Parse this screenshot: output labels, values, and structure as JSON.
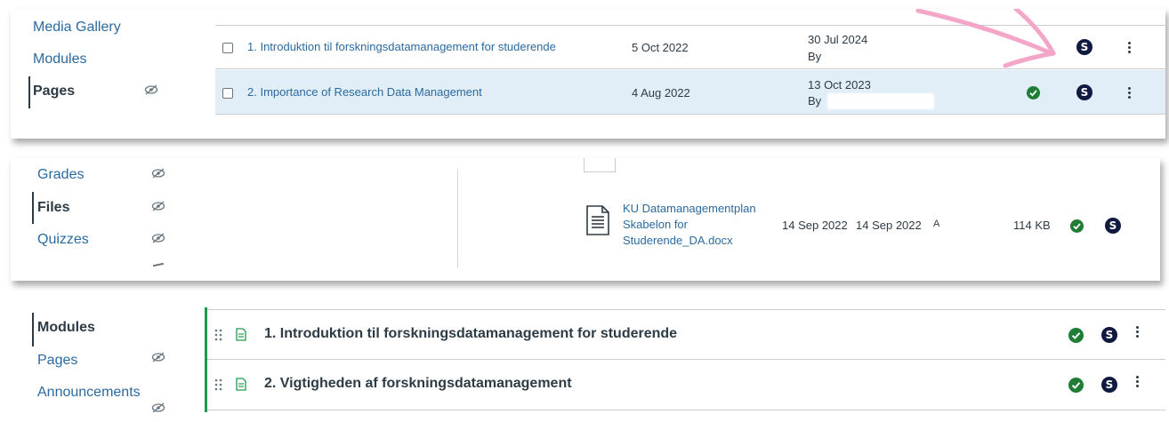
{
  "panel1": {
    "nav": {
      "media_gallery": "Media Gallery",
      "modules": "Modules",
      "pages": "Pages"
    },
    "rows": [
      {
        "title": "1. Introduktion til forskningsdatamanagement for studerende",
        "created": "5 Oct 2022",
        "updated": "30 Jul 2024",
        "by": "By",
        "published": false
      },
      {
        "title": "2. Importance of Research Data Management",
        "created": "4 Aug 2022",
        "updated": "13 Oct 2023",
        "by": "By",
        "published": true
      }
    ]
  },
  "panel2": {
    "nav": {
      "grades": "Grades",
      "files": "Files",
      "quizzes": "Quizzes"
    },
    "file": {
      "name_line1": "KU Datamanagementplan",
      "name_line2": "Skabelon for",
      "name_line3": "Studerende_DA.docx",
      "created": "14 Sep 2022",
      "modified": "14 Sep 2022",
      "modified_by": "A",
      "size": "114 KB"
    }
  },
  "panel3": {
    "nav": {
      "modules": "Modules",
      "pages": "Pages",
      "announcements": "Announcements"
    },
    "items": [
      {
        "title": "1. Introduktion til forskningsdatamanagement for studerende"
      },
      {
        "title": "2. Vigtigheden af forskningsdatamanagement"
      }
    ]
  },
  "icons": {
    "published": "check-circle-icon",
    "student_view": "s-badge-icon",
    "more": "kebab-menu-icon",
    "hidden": "eye-slash-icon",
    "drag": "drag-handle-icon",
    "page": "page-document-icon",
    "file": "docx-file-icon"
  },
  "colors": {
    "link": "#2b6a9f",
    "published_green": "#1f7d36",
    "s_badge_navy": "#101a40",
    "row_highlight": "#e1eef7",
    "module_bar": "#1f9c4b",
    "arrow_pink": "#f4a6c8"
  }
}
